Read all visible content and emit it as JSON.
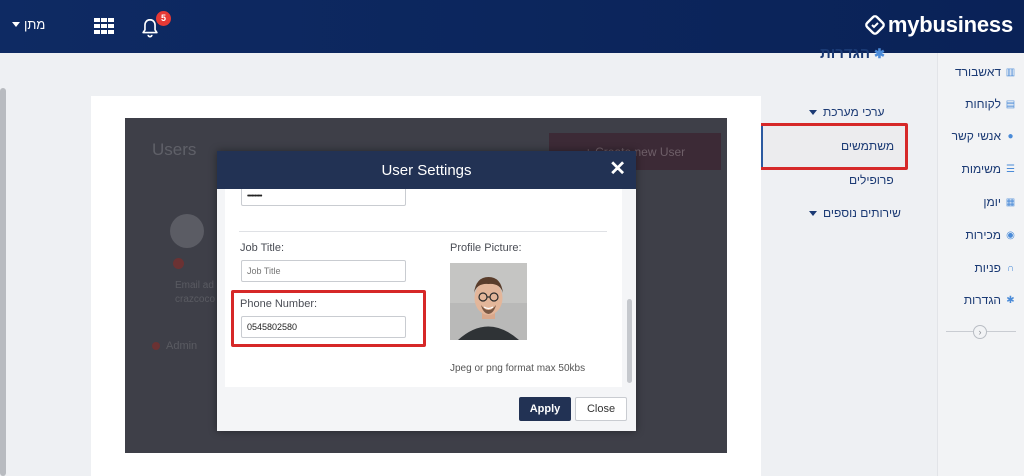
{
  "topbar": {
    "user_menu_label": "מתן",
    "notification_count": "5",
    "logo_text": "mybusiness"
  },
  "sidebar": {
    "items": [
      {
        "label": "דאשבורד",
        "icon": "bar-chart-icon"
      },
      {
        "label": "לקוחות",
        "icon": "building-icon"
      },
      {
        "label": "אנשי קשר",
        "icon": "user-icon"
      },
      {
        "label": "משימות",
        "icon": "list-icon"
      },
      {
        "label": "יומן",
        "icon": "calendar-icon"
      },
      {
        "label": "מכירות",
        "icon": "eye-icon"
      },
      {
        "label": "פניות",
        "icon": "headset-icon"
      },
      {
        "label": "הגדרות",
        "icon": "gear-icon"
      }
    ]
  },
  "settings": {
    "title": "הגדרות",
    "nav": [
      {
        "label": "ערכי מערכת",
        "has_caret": true
      },
      {
        "label": "משתמשים",
        "selected": true
      },
      {
        "label": "פרופילים"
      },
      {
        "label": "שירותים נוספים",
        "has_caret": true
      }
    ]
  },
  "background_card": {
    "heading": "Users",
    "add_button_label": "+ Create new User",
    "line1": "Email ad",
    "line2": "crazcoco",
    "role": "Admin"
  },
  "modal": {
    "title": "User Settings",
    "password_value": "••••••••••",
    "job_title_label": "Job Title:",
    "job_title_placeholder": "Job Title",
    "phone_label": "Phone Number:",
    "phone_value": "0545802580",
    "profile_picture_label": "Profile Picture:",
    "picture_hint": "Jpeg or png format max 50kbs",
    "apply_label": "Apply",
    "close_label": "Close"
  },
  "colors": {
    "topbar": "#0e2a63",
    "accent": "#223254",
    "highlight": "#d62828"
  }
}
